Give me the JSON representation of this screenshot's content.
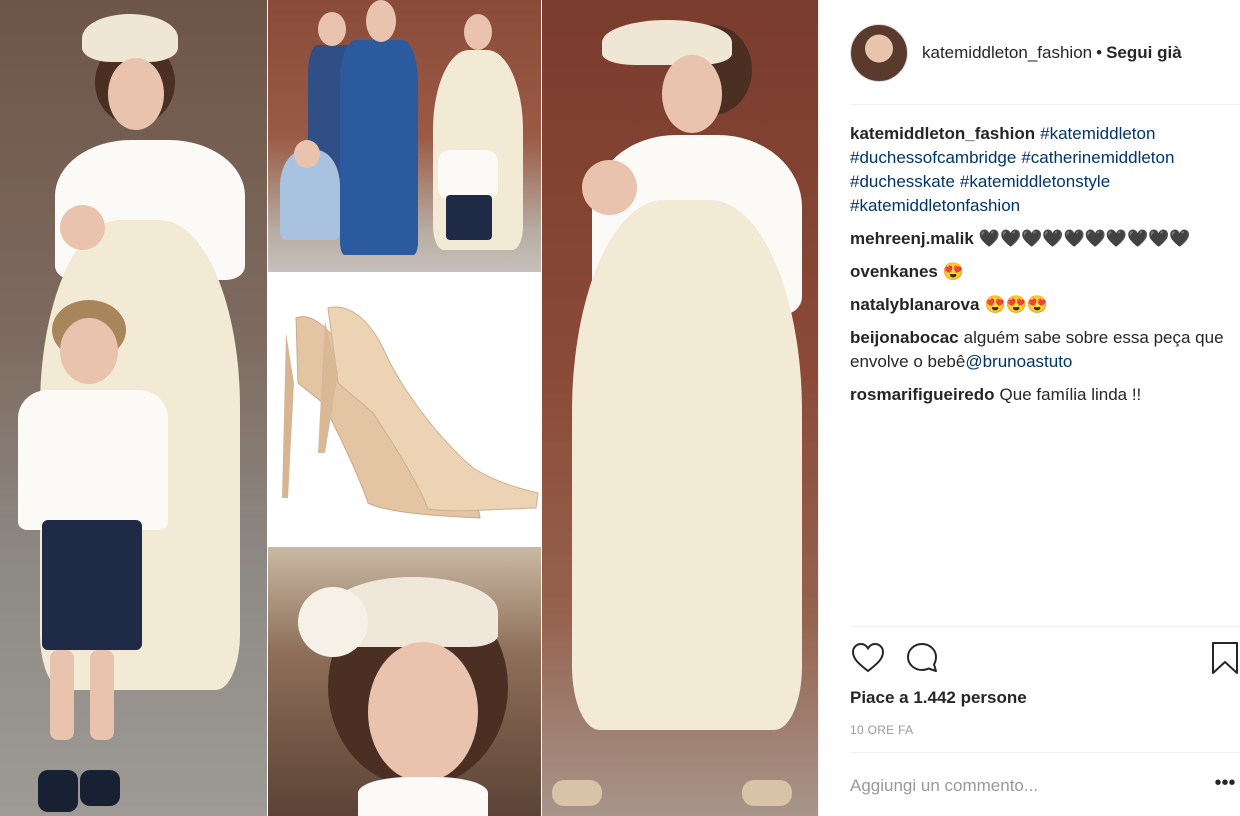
{
  "post": {
    "username": "katemiddleton_fashion",
    "separator": "•",
    "follow_label": "Segui già",
    "caption": {
      "username": "katemiddleton_fashion",
      "hashtags": [
        "#katemiddleton",
        "#duchessofcambridge",
        "#catherinemiddleton",
        "#duchesskate",
        "#katemiddletonstyle",
        "#katemiddletonfashion"
      ]
    },
    "comments": [
      {
        "user": "mehreenj.malik",
        "text": "🖤🖤🖤🖤🖤🖤🖤🖤🖤🖤"
      },
      {
        "user": "ovenkanes",
        "text": "😍"
      },
      {
        "user": "natalyblanarova",
        "text": "😍😍😍"
      },
      {
        "user": "beijonabocac",
        "text": "alguém sabe sobre essa peça que envolve o bebê",
        "mention": "@brunoastuto"
      },
      {
        "user": "rosmarifigueiredo",
        "text": "Que família linda !!"
      }
    ],
    "likes_label": "Piace a 1.442 persone",
    "time_label": "10 ORE FA",
    "add_comment_placeholder": "Aggiungi un commento...",
    "more_label": "•••"
  },
  "icons": {
    "like": "heart-icon",
    "comment": "comment-bubble-icon",
    "save": "bookmark-icon",
    "more": "more-options-icon"
  },
  "colors": {
    "link": "#003569",
    "muted": "#999999",
    "text": "#262626"
  }
}
